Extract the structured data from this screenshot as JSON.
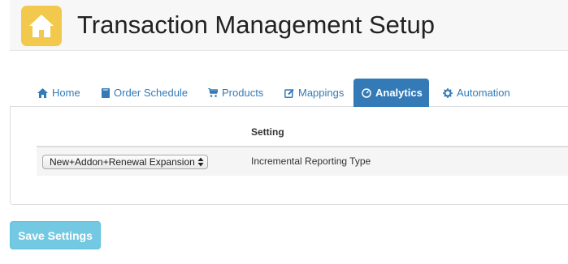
{
  "header": {
    "title": "Transaction Management Setup",
    "logo_icon": "home-icon",
    "logo_color": "#f2c94c"
  },
  "tabs": [
    {
      "label": "Home",
      "icon": "home-icon",
      "active": false
    },
    {
      "label": "Order Schedule",
      "icon": "book-icon",
      "active": false
    },
    {
      "label": "Products",
      "icon": "cart-icon",
      "active": false
    },
    {
      "label": "Mappings",
      "icon": "edit-icon",
      "active": false
    },
    {
      "label": "Analytics",
      "icon": "dashboard-icon",
      "active": true
    },
    {
      "label": "Automation",
      "icon": "gear-icon",
      "active": false
    }
  ],
  "table": {
    "header_setting": "Setting",
    "rows": [
      {
        "value": "New+Addon+Renewal Expansion",
        "setting": "Incremental Reporting Type"
      }
    ]
  },
  "save_button": {
    "label": "Save Settings"
  },
  "colors": {
    "accent": "#337ab7",
    "save": "#5bc0de"
  }
}
